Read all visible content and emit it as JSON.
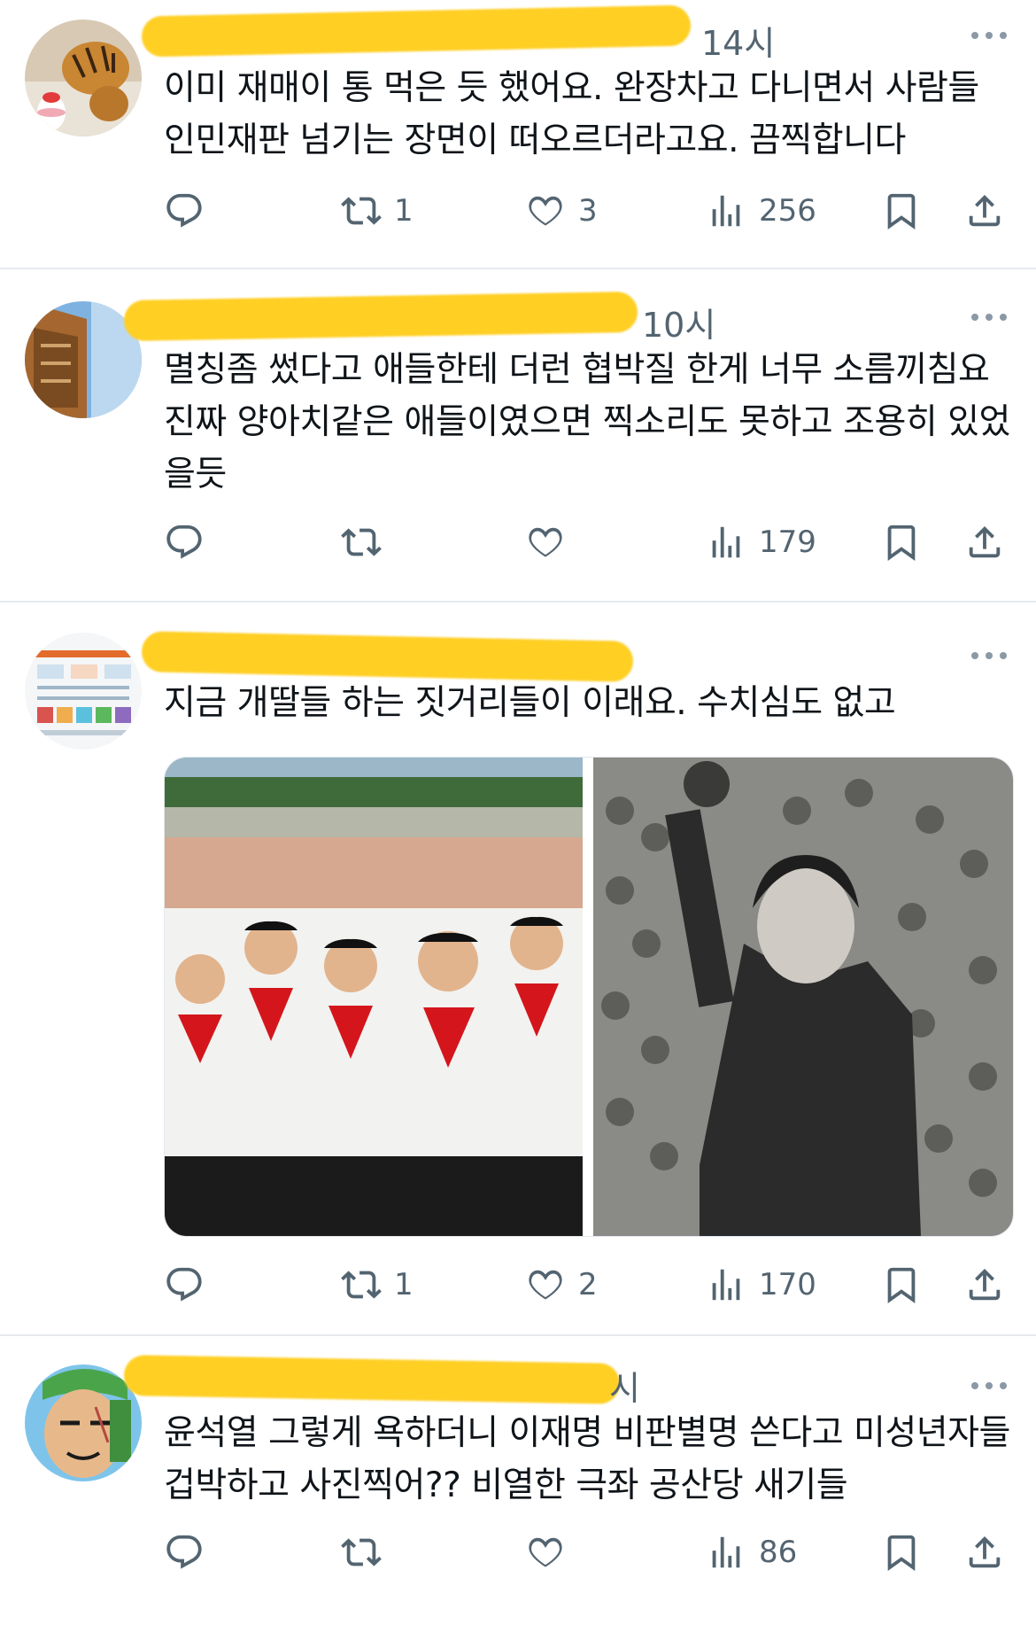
{
  "tweets": [
    {
      "time": "14시",
      "text": "이미 재매이 통 먹은 듯 했어요. 완장차고 다니면서 사람들 인민재판 넘기는 장면이 떠오르더라고요. 끔찍합니다",
      "reply_count": "",
      "retweet_count": "1",
      "like_count": "3",
      "view_count": "256"
    },
    {
      "time": "10시",
      "text": "멸칭좀 썼다고 애들한테 더런 협박질 한게 너무 소름끼침요 진짜 양아치같은 애들이였으면 찍소리도 못하고 조용히 있었을듯",
      "reply_count": "",
      "retweet_count": "",
      "like_count": "",
      "view_count": "179"
    },
    {
      "time": "",
      "text": "지금 개딸들 하는 짓거리들이 이래요. 수치심도 없고",
      "reply_count": "",
      "retweet_count": "1",
      "like_count": "2",
      "view_count": "170"
    },
    {
      "time": "시",
      "text": "윤석열 그렇게 욕하더니 이재명 비판별명 쓴다고 미성년자들 겁박하고 사진찍어?? 비열한 극좌 공산당 새기들",
      "reply_count": "",
      "retweet_count": "",
      "like_count": "",
      "view_count": "86"
    }
  ],
  "icons": {
    "reply": "reply-icon",
    "retweet": "retweet-icon",
    "like": "heart-icon",
    "views": "views-icon",
    "bookmark": "bookmark-icon",
    "share": "share-icon",
    "more": "more-icon"
  },
  "colors": {
    "text": "#0f1419",
    "muted": "#536471",
    "mask": "#ffcf24",
    "separator": "#e6e9ec"
  }
}
